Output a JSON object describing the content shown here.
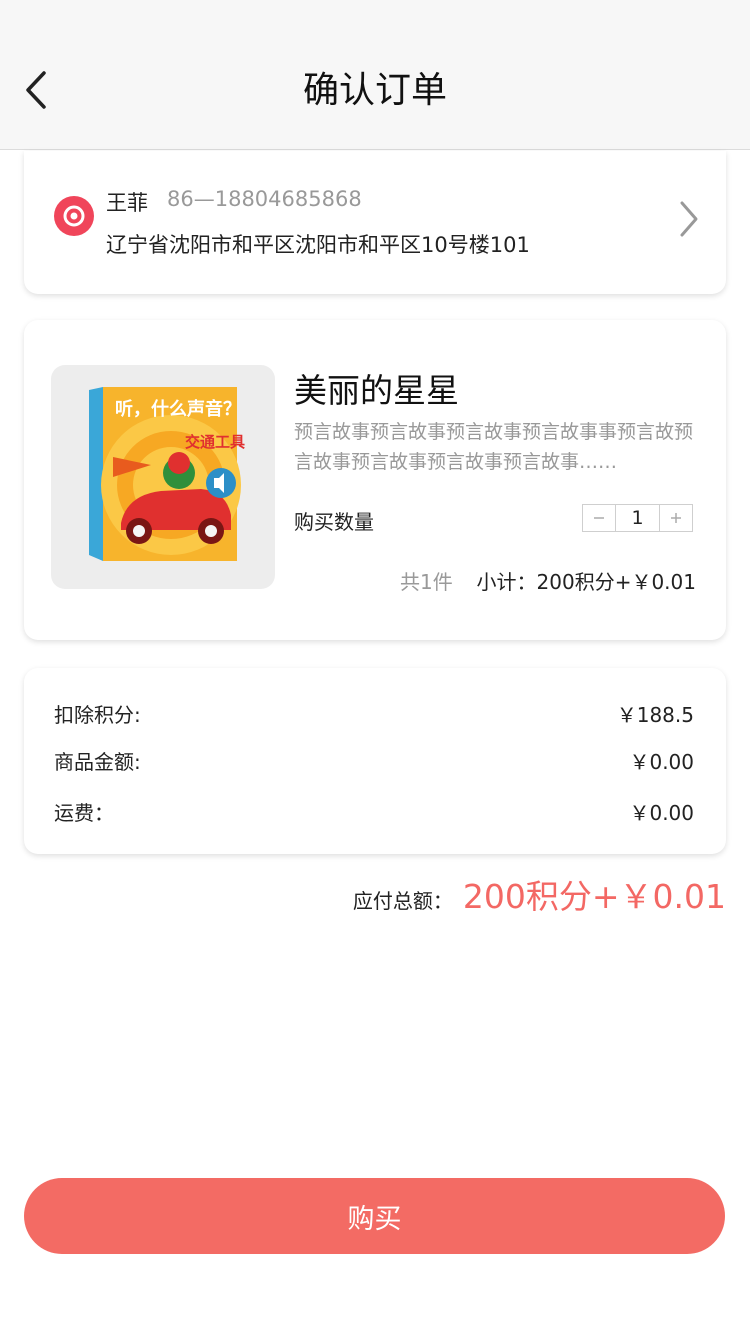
{
  "header": {
    "title": "确认订单"
  },
  "address": {
    "name": "王菲",
    "phone": "86—18804685868",
    "detail": "辽宁省沈阳市和平区沈阳市和平区10号楼101"
  },
  "product": {
    "title": "美丽的星星",
    "description": "预言故事预言故事预言故事预言故事事预言故预言故事预言故事预言故事预言故事……",
    "quantity_label": "购买数量",
    "quantity": "1",
    "count_text": "共1件",
    "subtotal": "小计：200积分+￥0.01",
    "cover_text": {
      "title": "听，什么声音？",
      "subtitle": "交通工具"
    }
  },
  "price": {
    "rows": [
      {
        "label": "扣除积分:",
        "value": "￥188.5"
      },
      {
        "label": "商品金额:",
        "value": "￥0.00"
      },
      {
        "label": "运费：",
        "value": "￥0.00"
      }
    ]
  },
  "total": {
    "label": "应付总额：",
    "value": "200积分+￥0.01"
  },
  "buy_button": {
    "label": "购买"
  },
  "colors": {
    "accent": "#f36864",
    "location": "#f0455a"
  }
}
